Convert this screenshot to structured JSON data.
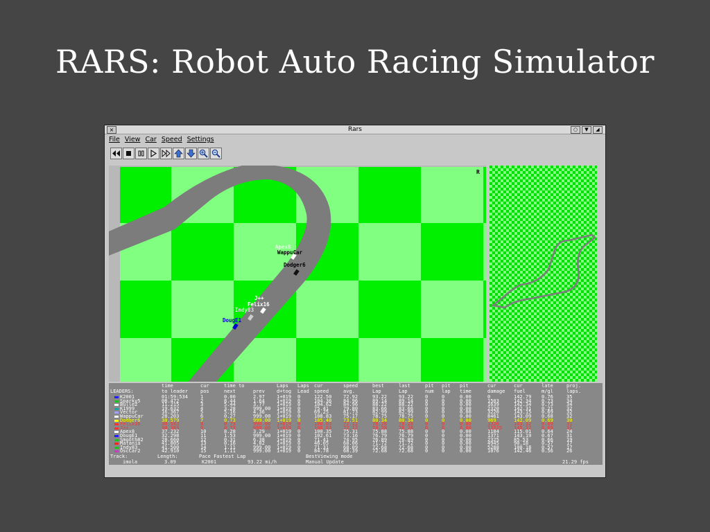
{
  "slide": {
    "title": "RARS: Robot Auto Racing Simulator"
  },
  "window": {
    "title": "Rars",
    "close_glyph": "×"
  },
  "menu": {
    "items": [
      "File",
      "View",
      "Car",
      "Speed",
      "Settings"
    ]
  },
  "toolbar": {
    "buttons": [
      "rewind-icon",
      "stop-icon",
      "pause-icon",
      "play-icon",
      "fast-forward-icon",
      "arrow-up-icon",
      "arrow-down-icon",
      "zoom-in-icon",
      "zoom-out-icon"
    ]
  },
  "track": {
    "corner_label": "R"
  },
  "cars_on_track": [
    {
      "name": "Apex8",
      "color": "#ffffff"
    },
    {
      "name": "WappuCar",
      "color": "#ffffff"
    },
    {
      "name": "Dodger6",
      "color": "#000000"
    },
    {
      "name": "J++",
      "color": "#ffffff"
    },
    {
      "name": "Felix16",
      "color": "#ffffff"
    },
    {
      "name": "Indy83",
      "color": "#e0e0e0"
    },
    {
      "name": "DougE1",
      "color": "#0000cc"
    }
  ],
  "stats": {
    "headers": [
      {
        "line1": "",
        "line2": "LEADERS:"
      },
      {
        "line1": "time",
        "line2": "to leader"
      },
      {
        "line1": "cur",
        "line2": "pos"
      },
      {
        "line1": "time to",
        "line2": "next"
      },
      {
        "line1": "",
        "line2": "prev"
      },
      {
        "line1": "Laps",
        "line2": "d+tog"
      },
      {
        "line1": "Laps",
        "line2": "Lead"
      },
      {
        "line1": "cur",
        "line2": "speed"
      },
      {
        "line1": "speed",
        "line2": "avg."
      },
      {
        "line1": "best",
        "line2": "Lap"
      },
      {
        "line1": "last",
        "line2": "Lap"
      },
      {
        "line1": "pit",
        "line2": "num"
      },
      {
        "line1": "pit",
        "line2": "lap"
      },
      {
        "line1": "pit",
        "line2": "time"
      },
      {
        "line1": "cur",
        "line2": "damage"
      },
      {
        "line1": "cur",
        "line2": "fuel"
      },
      {
        "line1": "late",
        "line2": "m/gl"
      },
      {
        "line1": "proj.",
        "line2": "laps."
      }
    ],
    "rows": [
      {
        "style": "normal",
        "color": "#2020ff",
        "cells": [
          "K2001",
          "01:59:534",
          "1",
          "0.00",
          "2.97",
          "1+019",
          "0",
          "122.50",
          "72.92",
          "93.22",
          "93.22",
          "0",
          "0",
          "0.00",
          "0",
          "142.79",
          "0.76",
          "35"
        ]
      },
      {
        "style": "normal",
        "color": "#20c020",
        "cells": [
          "Sparky5",
          "08.472",
          "2",
          "8.44",
          "1.64",
          "1+019",
          "0",
          "104.36",
          "84.96",
          "89.14",
          "89.14",
          "0",
          "0",
          "0.00",
          "1503",
          "142.34",
          "0.73",
          "34"
        ]
      },
      {
        "style": "normal",
        "color": "#ffffff",
        "cells": [
          "Bulle2",
          "11.215",
          "3",
          "5.44",
          "3.77",
          "1+019",
          "0",
          "104.62",
          "84.96",
          "88.22",
          "88.22",
          "0",
          "0",
          "0.00",
          "1639",
          "142.34",
          "0.73",
          "34"
        ]
      },
      {
        "style": "normal",
        "color": "#20a0a0",
        "cells": [
          "K1999",
          "19.632",
          "4",
          "3.28",
          "999.00",
          "1+019",
          "0",
          "75.41",
          "79.80",
          "83.66",
          "83.66",
          "0",
          "0",
          "0.00",
          "2320",
          "142.31",
          "0.21",
          "32"
        ]
      },
      {
        "style": "normal",
        "color": "#a0a0ff",
        "cells": [
          "Vector",
          "16.367",
          "5",
          "5.16",
          "4.36",
          "1+019",
          "0",
          "69.25",
          "81.73",
          "82.99",
          "82.99",
          "0",
          "0",
          "0.00",
          "3220",
          "143.15",
          "0.69",
          "32"
        ]
      },
      {
        "style": "normal",
        "color": "#ffffff",
        "cells": [
          "WappuCar",
          "28.203",
          "6",
          "0.27",
          "999.00",
          "1+019",
          "0",
          "108.83",
          "75.17",
          "78.75",
          "78.75",
          "0",
          "0",
          "0.00",
          "8461",
          "143.09",
          "0.68",
          "32"
        ]
      },
      {
        "style": "highlight",
        "color": "#ffff00",
        "cells": [
          "Dodger6",
          "30.579",
          "7",
          "0.73",
          "999.00",
          "1+019",
          "0",
          "105.40",
          "73.51",
          "80.34",
          "80.34",
          "0",
          "0",
          "0.00",
          "969",
          "142.09",
          "0.69",
          "30"
        ]
      },
      {
        "style": "red",
        "color": "#ff3030",
        "cells": [
          "Felix16",
          "30.583",
          "8",
          "0.73",
          "999.00",
          "1+019",
          "0",
          "100.03",
          "72.12",
          "78.28",
          "78.28",
          "0",
          "0",
          "0.00",
          "1326",
          "145.12",
          "0.69",
          "31"
        ]
      },
      {
        "style": "red",
        "color": "#ff3030",
        "cells": [
          "J++",
          "30.383",
          "9",
          "0.73",
          "999.00",
          "1+019",
          "0",
          "100.03",
          "72.12",
          "78.28",
          "78.28",
          "0",
          "0",
          "0.00",
          "13525",
          "145.12",
          "0.69",
          "31"
        ]
      },
      {
        "style": "normal",
        "color": "#ffffff",
        "cells": [
          "Apex8",
          "37.232",
          "10",
          "8.28",
          "3.29",
          "1+019",
          "0",
          "100.35",
          "75.31",
          "75.88",
          "75.88",
          "0",
          "0",
          "0.00",
          "1184",
          "115.01",
          "0.64",
          "24"
        ]
      },
      {
        "style": "normal",
        "color": "#2020ff",
        "cells": [
          "DougE1",
          "32.298",
          "11",
          "1.53",
          "999.00",
          "1+019",
          "0",
          "102.61",
          "73.16",
          "76.79",
          "76.79",
          "0",
          "0",
          "0.00",
          "1371",
          "143.19",
          "0.67",
          "31"
        ]
      },
      {
        "style": "normal",
        "color": "#20c020",
        "cells": [
          "Smooth82",
          "28.660",
          "12",
          "0.31",
          "6.38",
          "1+019",
          "0",
          "71.41",
          "74.95",
          "76.89",
          "76.89",
          "0",
          "0",
          "0.00",
          "2325",
          "85.53",
          "0.66",
          "19"
        ]
      },
      {
        "style": "normal",
        "color": "#ff2020",
        "cells": [
          "Mafania",
          "41.805",
          "13",
          "0.16",
          "4.02",
          "1+019",
          "0",
          "46.05",
          "68.06",
          "71.72",
          "71.72",
          "0",
          "0",
          "0.00",
          "4945",
          "90.18",
          "0.57",
          "17"
        ]
      },
      {
        "style": "normal",
        "color": "#20c020",
        "cells": [
          "Indy83",
          "41.500",
          "14",
          "1.11",
          "999.00",
          "1+019",
          "0",
          "71.31",
          "68.09",
          "72.68",
          "72.68",
          "0",
          "0",
          "0.00",
          "5288",
          "100.18",
          "0.57",
          "17"
        ]
      },
      {
        "style": "normal",
        "color": "#c040c0",
        "cells": [
          "OscCar2",
          "42.910",
          "15",
          "1.11",
          "999.00",
          "1+019",
          "0",
          "84.78",
          "68.39",
          "72.68",
          "72.68",
          "0",
          "0",
          "0.00",
          "1076",
          "142.46",
          "0.56",
          "26"
        ]
      }
    ],
    "footer": {
      "track_label": "Track:",
      "track_value": "imola",
      "length_label": "Length:",
      "length_value": "3.09",
      "pace_label": "Pace Fastest Lap",
      "pace_car": "K2001",
      "pace_value": "93.22 mi/h",
      "mode_label": "BestViewing mode",
      "mode_value": "Manual Update",
      "fps": "21.29 fps"
    }
  }
}
